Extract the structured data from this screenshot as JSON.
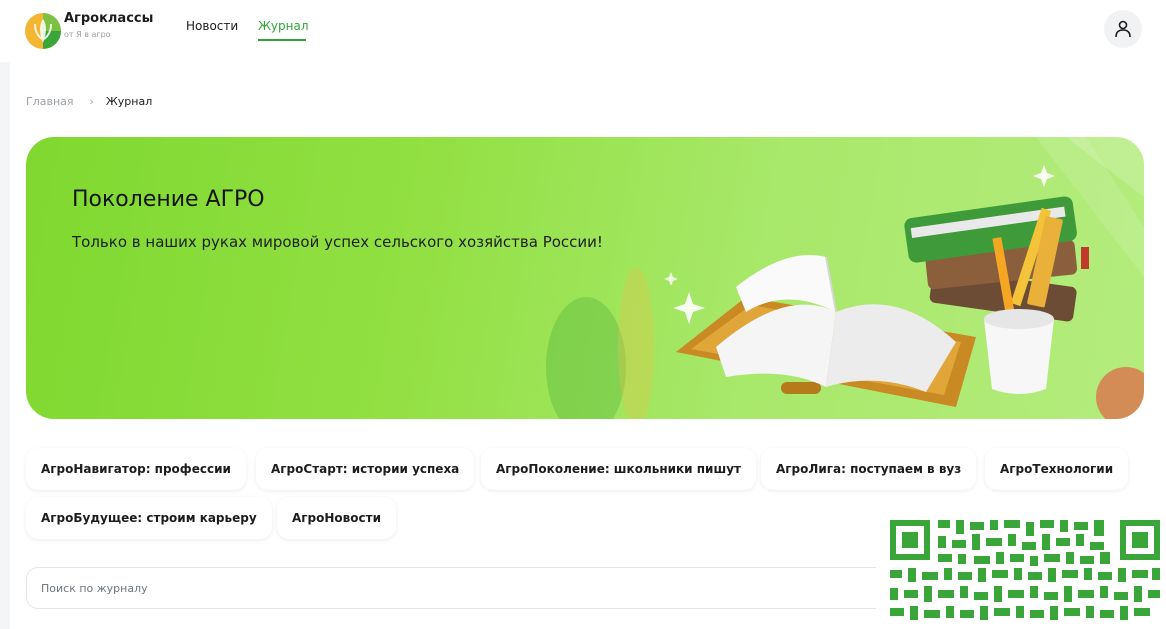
{
  "header": {
    "brand_title": "Агроклассы",
    "brand_subtitle": "от Я в агро",
    "nav": [
      {
        "label": "Новости",
        "active": false
      },
      {
        "label": "Журнал",
        "active": true
      }
    ],
    "logo_icon": "wheat-leaf-icon",
    "user_icon": "user-icon"
  },
  "breadcrumb": {
    "home": "Главная",
    "separator": "›",
    "current": "Журнал"
  },
  "banner": {
    "title": "Поколение АГРО",
    "text": "Только в наших руках мировой успех сельского хозяйства России!",
    "illustration_icon": "books-illustration"
  },
  "categories": [
    "АгроНавигатор: профессии",
    "АгроСтарт: истории успеха",
    "АгроПоколение: школьники пишут",
    "АгроЛига: поступаем в вуз",
    "АгроТехнологии",
    "АгроБудущее: строим карьеру",
    "АгроНовости"
  ],
  "search": {
    "placeholder": "Поиск по журналу",
    "value": ""
  },
  "qr_code_icon": "qr-code-icon",
  "colors": {
    "accent": "#2fa43a",
    "banner_green": "#92e043",
    "qr_green": "#3aa63a"
  }
}
